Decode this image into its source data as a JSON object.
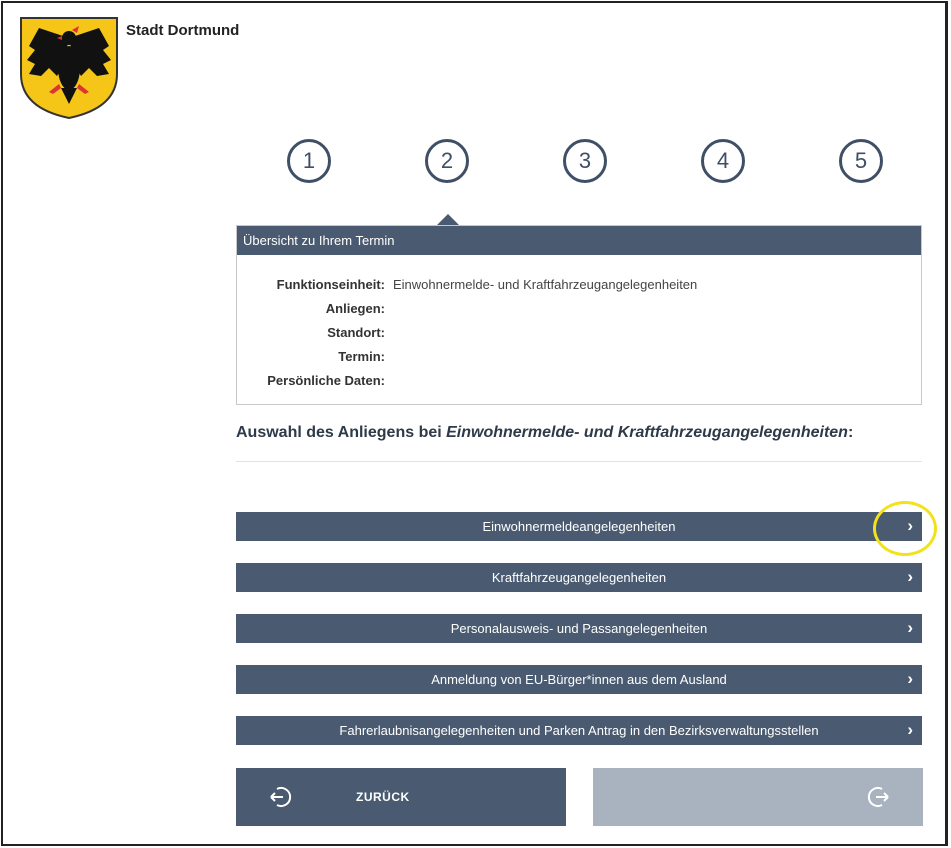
{
  "header": {
    "brand": "Stadt Dortmund"
  },
  "steps": [
    "1",
    "2",
    "3",
    "4",
    "5"
  ],
  "active_step": 2,
  "overview": {
    "title": "Übersicht zu Ihrem Termin",
    "rows": [
      {
        "label": "Funktionseinheit:",
        "value": "Einwohnermelde- und Kraftfahrzeugangelegenheiten"
      },
      {
        "label": "Anliegen:",
        "value": ""
      },
      {
        "label": "Standort:",
        "value": ""
      },
      {
        "label": "Termin:",
        "value": ""
      },
      {
        "label": "Persönliche Daten:",
        "value": ""
      }
    ]
  },
  "selection": {
    "heading_prefix": "Auswahl des Anliegens bei ",
    "heading_emph": "Einwohnermelde- und Kraftfahrzeugangelegenheiten",
    "heading_suffix": ":"
  },
  "choices": [
    {
      "label": "Einwohnermeldeangelegenheiten",
      "chevron": "›"
    },
    {
      "label": "Kraftfahrzeugangelegenheiten",
      "chevron": "›"
    },
    {
      "label": "Personalausweis- und Passangelegenheiten",
      "chevron": "›"
    },
    {
      "label": "Anmeldung von EU-Bürger*innen aus dem Ausland",
      "chevron": "›"
    },
    {
      "label": "Fahrerlaubnisangelegenheiten und Parken Antrag in den Bezirksverwaltungsstellen",
      "chevron": "›"
    }
  ],
  "navigation": {
    "back_label": "ZURÜCK",
    "back_icon": "back-arrow-icon",
    "next_icon": "next-arrow-icon",
    "next_enabled": false
  },
  "colors": {
    "bar": "#4a5a70",
    "disabled": "#a9b3bf",
    "highlight": "#f2e21c",
    "logo_shield": "#f5c518"
  }
}
